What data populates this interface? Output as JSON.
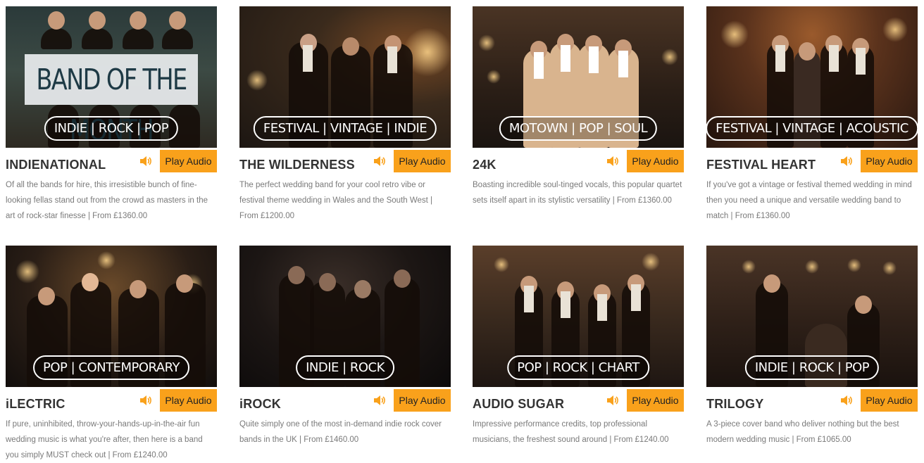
{
  "accent_color": "#f9a11b",
  "banner_text": "BAND OF THE MONTH",
  "play_label": "Play Audio",
  "speaker_icon": "speaker-icon",
  "bands": [
    {
      "name": "INDIENATIONAL",
      "genres": "INDIE | ROCK | POP",
      "description": "Of all the bands for hire, this irresistible bunch of fine-looking fellas stand out from the crowd as masters in the art of rock-star finesse | From £1360.00"
    },
    {
      "name": "THE WILDERNESS",
      "genres": "FESTIVAL | VINTAGE | INDIE",
      "description": "The perfect wedding band for your cool retro vibe or festival theme wedding in Wales and the South West | From £1200.00"
    },
    {
      "name": "24K",
      "genres": "MOTOWN | POP | SOUL",
      "description": "Boasting incredible soul-tinged vocals, this popular quartet sets itself apart in its stylistic versatility | From £1360.00"
    },
    {
      "name": "FESTIVAL HEART",
      "genres": "FESTIVAL | VINTAGE | ACOUSTIC",
      "description": "If you've got a vintage or festival themed wedding in mind then you need a unique and versatile wedding band to match | From £1360.00"
    },
    {
      "name": "iLECTRIC",
      "genres": "POP | CONTEMPORARY",
      "description": "If pure, uninhibited, throw-your-hands-up-in-the-air fun wedding music is what you're after, then here is a band you simply MUST check out | From £1240.00"
    },
    {
      "name": "iROCK",
      "genres": "INDIE | ROCK",
      "description": "Quite simply one of the most in-demand indie rock cover bands in the UK | From £1460.00"
    },
    {
      "name": "AUDIO SUGAR",
      "genres": "POP | ROCK | CHART",
      "description": "Impressive performance credits, top professional musicians, the freshest sound around | From £1240.00"
    },
    {
      "name": "TRILOGY",
      "genres": "INDIE | ROCK | POP",
      "description": "A 3-piece cover band who deliver nothing but the best modern wedding music | From £1065.00"
    }
  ]
}
